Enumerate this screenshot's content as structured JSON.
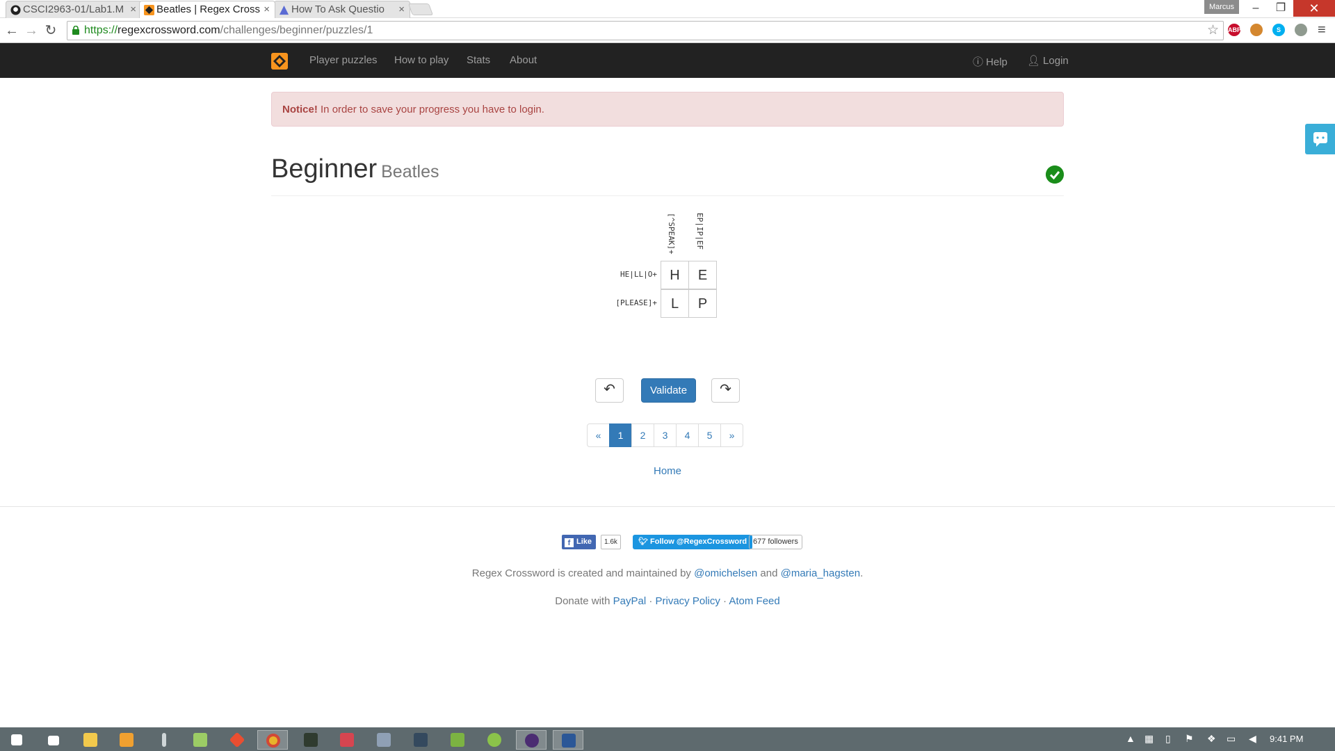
{
  "browser": {
    "tabs": [
      {
        "title": "CSCI2963-01/Lab1.M",
        "favicon": "github-icon"
      },
      {
        "title": "Beatles | Regex Cross",
        "favicon": "regex-crossword-icon"
      },
      {
        "title": "How To Ask Questio",
        "favicon": "triangle-icon"
      }
    ],
    "profile_name": "Marcus",
    "url": {
      "scheme": "https://",
      "domain": "regexcrossword.com",
      "path": "/challenges/beginner/puzzles/1"
    },
    "extensions": [
      {
        "label": "ABP",
        "color": "#c70d2c"
      },
      {
        "label": "",
        "color": "#d4872f"
      },
      {
        "label": "S",
        "color": "#00aff0"
      },
      {
        "label": "",
        "color": "#8f9a8f"
      }
    ]
  },
  "site_nav": {
    "links": [
      "Player puzzles",
      "How to play",
      "Stats",
      "About"
    ],
    "help": "Help",
    "login": "Login"
  },
  "notice": {
    "strong": "Notice!",
    "text": " In order to save your progress you have to login."
  },
  "puzzle": {
    "difficulty": "Beginner",
    "name": "Beatles",
    "solved": true,
    "column_clues": [
      "[^SPEAK]+",
      "EP|IP|EF"
    ],
    "row_clues": [
      "HE|LL|O+",
      "[PLEASE]+"
    ],
    "grid": [
      [
        "H",
        "E"
      ],
      [
        "L",
        "P"
      ]
    ]
  },
  "controls": {
    "validate_label": "Validate"
  },
  "pagination": {
    "prev": "«",
    "pages": [
      "1",
      "2",
      "3",
      "4",
      "5"
    ],
    "current": "1",
    "next": "»"
  },
  "home_link": "Home",
  "footer": {
    "fb_like_label": "Like",
    "fb_like_count": "1.6k",
    "twitter_follow_label": "Follow @RegexCrossword",
    "twitter_followers": "677 followers",
    "credits_prefix": "Regex Crossword is created and maintained by ",
    "author1": "@omichelsen",
    "credits_and": " and ",
    "author2": "@maria_hagsten",
    "credits_suffix": ".",
    "donate_prefix": "Donate with ",
    "paypal": "PayPal",
    "sep": " · ",
    "privacy": "Privacy Policy",
    "atom": "Atom Feed"
  },
  "taskbar": {
    "time": "9:41 PM",
    "apps": [
      {
        "name": "start-icon",
        "color": "#ffffff"
      },
      {
        "name": "home-icon",
        "color": "#ffffff"
      },
      {
        "name": "file-explorer-icon",
        "color": "#f2c94c"
      },
      {
        "name": "sublime-icon",
        "color": "#f0a030"
      },
      {
        "name": "pen-icon",
        "color": "#cfd6d8"
      },
      {
        "name": "folder-icon",
        "color": "#9ccc65"
      },
      {
        "name": "git-icon",
        "color": "#e94e31"
      },
      {
        "name": "chrome-icon",
        "color": "#e8b32b"
      },
      {
        "name": "terminal-icon",
        "color": "#2f3b2f"
      },
      {
        "name": "tools-icon",
        "color": "#d64550"
      },
      {
        "name": "app-icon",
        "color": "#8fa0b5"
      },
      {
        "name": "paint-icon",
        "color": "#34495e"
      },
      {
        "name": "grid-app-icon",
        "color": "#7cb342"
      },
      {
        "name": "android-icon",
        "color": "#8bc34a"
      },
      {
        "name": "eclipse-icon",
        "color": "#4b2c72"
      },
      {
        "name": "word-icon",
        "color": "#2b5797"
      }
    ]
  }
}
